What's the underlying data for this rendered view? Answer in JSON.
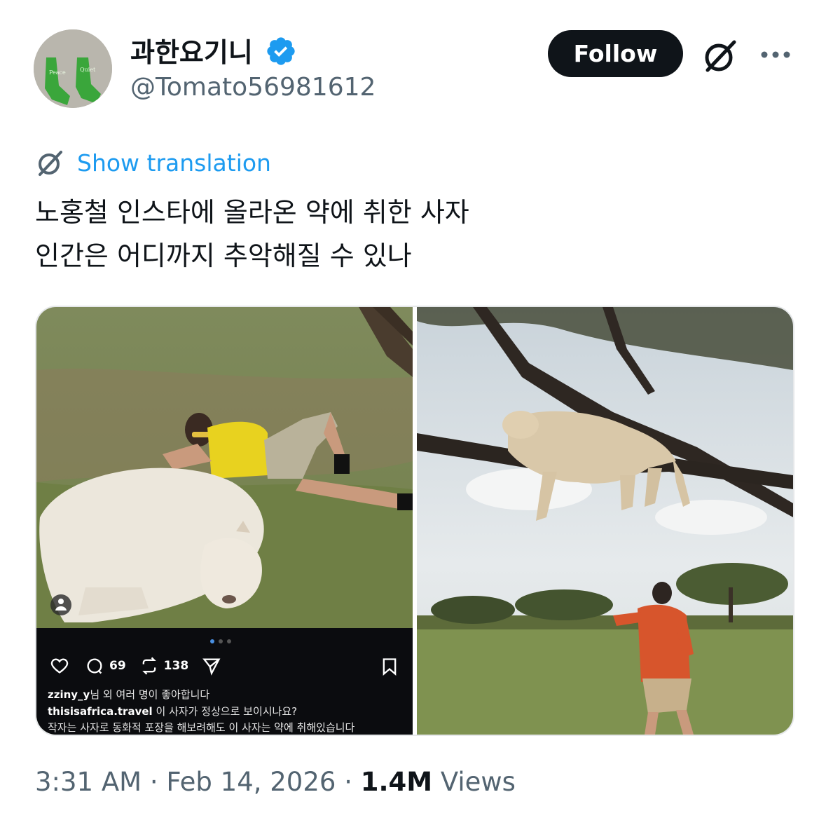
{
  "author": {
    "name": "과한요기니",
    "handle": "@Tomato56981612",
    "verified_color": "#1d9bf0",
    "avatar_sock_text": [
      "Peace",
      "Quiet"
    ]
  },
  "follow_label": "Follow",
  "translate_link": "Show translation",
  "tweet_text": [
    "노홍철 인스타에 올라온 약에 취한 사자",
    "인간은 어디까지 추악해질 수 있나"
  ],
  "embedded_post": {
    "like_icon": "heart-icon",
    "comment_count": "69",
    "repost_count": "138",
    "liked_by_user": "zziny_y",
    "liked_by_suffix": "님 외 여러 명이 좋아합니다",
    "caption_user": "thisisafrica.travel",
    "caption_text": " 이 사자가 정상으로 보이시나요?",
    "caption_continued": "작자는 사자로 동화적 포장을 해보려해도 이 사자는 약에 취해있습니다"
  },
  "timestamp": {
    "time": "3:31 AM",
    "date": "Feb 14, 2026",
    "views_count": "1.4M",
    "views_label": "Views",
    "separator": "·"
  },
  "colors": {
    "text": "#0f1419",
    "secondary": "#536471",
    "link": "#1d9bf0",
    "button_bg": "#0f1419"
  }
}
